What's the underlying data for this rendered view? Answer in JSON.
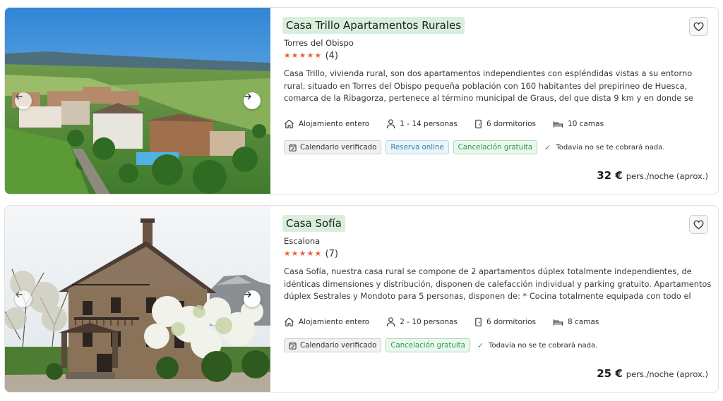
{
  "listings": [
    {
      "title": "Casa Trillo Apartamentos Rurales",
      "location": "Torres del Obispo",
      "stars": "★★★★★",
      "reviews": "(4)",
      "description": "Casa Trillo, vivienda rural, son dos apartamentos independientes con espléndidas vistas a su entorno rural, situado en Torres del Obispo pequeña población con 160 habitantes del prepirineo de Huesca, comarca de la Ribagorza, pertenece al término municipal de Graus, del que dista 9 km y en donde se dispone de todos los…",
      "facts": {
        "type": "Alojamiento entero",
        "people": "1 - 14 personas",
        "bedrooms": "6 dormitorios",
        "beds": "10 camas"
      },
      "tags": {
        "calendar": "Calendario verificado",
        "online": "Reserva online",
        "cancel": "Cancelación gratuita"
      },
      "no_charge": "Todavía no se te cobrará nada.",
      "price": "32 €",
      "price_unit": "pers./noche (aprox.)"
    },
    {
      "title": "Casa Sofía",
      "location": "Escalona",
      "stars": "★★★★★",
      "reviews": "(7)",
      "description": "Casa Sofía, nuestra casa rural se compone de 2 apartamentos dúplex totalmente independientes, de idénticas dimensiones y distribución, disponen de calefacción individual y parking gratuito. Apartamentos dúplex Sestrales y Mondoto para 5 personas, disponen de: * Cocina totalmente equipada con todo el menaje…",
      "facts": {
        "type": "Alojamiento entero",
        "people": "2 - 10 personas",
        "bedrooms": "6 dormitorios",
        "beds": "8 camas"
      },
      "tags": {
        "calendar": "Calendario verificado",
        "cancel": "Cancelación gratuita"
      },
      "no_charge": "Todavía no se te cobrará nada.",
      "price": "25 €",
      "price_unit": "pers./noche (aprox.)"
    }
  ],
  "icons": {
    "heart": "heart-icon",
    "arrow_left": "arrow-left-icon",
    "arrow_right": "arrow-right-icon",
    "home": "home-icon",
    "person": "person-icon",
    "door": "door-icon",
    "bed": "bed-icon",
    "calendar": "calendar-icon",
    "check": "check-icon"
  },
  "colors": {
    "title_highlight": "#d9eedb",
    "stars": "#ef5b3c",
    "tag_blue": "#2c86a8",
    "tag_green": "#2a9a4f"
  }
}
